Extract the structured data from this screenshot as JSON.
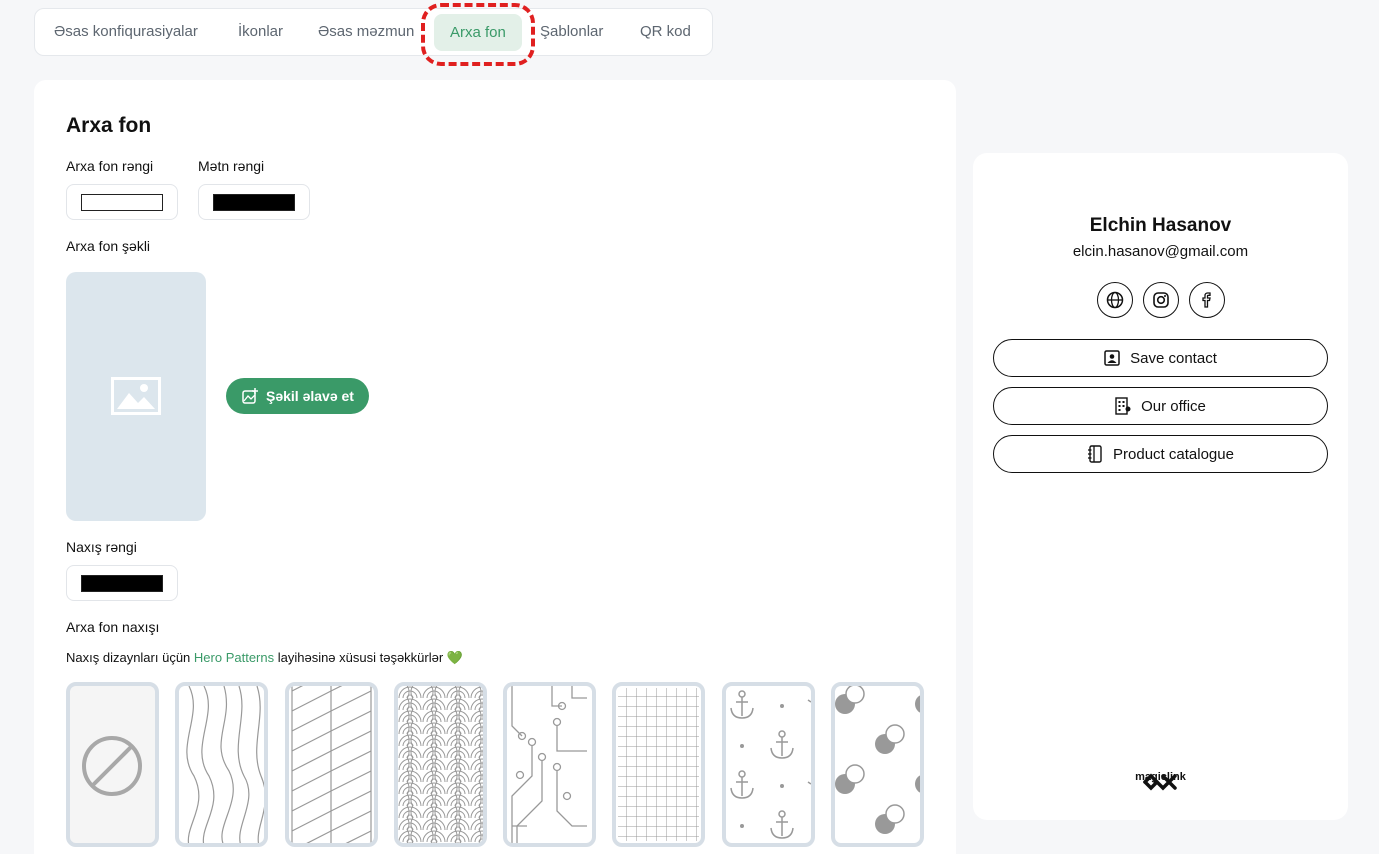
{
  "tabs": [
    {
      "label": "Əsas konfiqurasiyalar"
    },
    {
      "label": "İkonlar"
    },
    {
      "label": "Əsas məzmun"
    },
    {
      "label": "Arxa fon"
    },
    {
      "label": "Şablonlar"
    },
    {
      "label": "QR kod"
    }
  ],
  "active_tab": "Arxa fon",
  "editor": {
    "title": "Arxa fon",
    "bg_color_label": "Arxa fon rəngi",
    "bg_color_value": "#ffffff",
    "text_color_label": "Mətn rəngi",
    "text_color_value": "#000000",
    "bg_image_label": "Arxa fon şəkli",
    "add_image_button": "Şəkil əlavə et",
    "pattern_color_label": "Naxış rəngi",
    "pattern_color_value": "#000000",
    "pattern_label": "Arxa fon naxışı",
    "thanks_prefix": "Naxış dizaynları üçün ",
    "thanks_link": "Hero Patterns",
    "thanks_suffix": " layihəsinə xüsusi təşəkkürlər 💚",
    "patterns": [
      "none",
      "topography",
      "leaf",
      "waves",
      "circuit",
      "graph",
      "anchors",
      "bubbles"
    ]
  },
  "preview": {
    "name": "Elchin Hasanov",
    "email": "elcin.hasanov@gmail.com",
    "socials": [
      "globe-icon",
      "instagram-icon",
      "facebook-icon"
    ],
    "links": [
      {
        "label": "Save contact",
        "icon": "contact-icon"
      },
      {
        "label": "Our office",
        "icon": "building-icon"
      },
      {
        "label": "Product catalogue",
        "icon": "notebook-icon"
      }
    ],
    "brand": "magiclink"
  },
  "colors": {
    "accent": "#3a9a68",
    "accent_bg": "#e3f0e8",
    "highlight": "#e02020",
    "page_bg": "#f6f7f9",
    "placeholder_bg": "#dce6ed"
  }
}
